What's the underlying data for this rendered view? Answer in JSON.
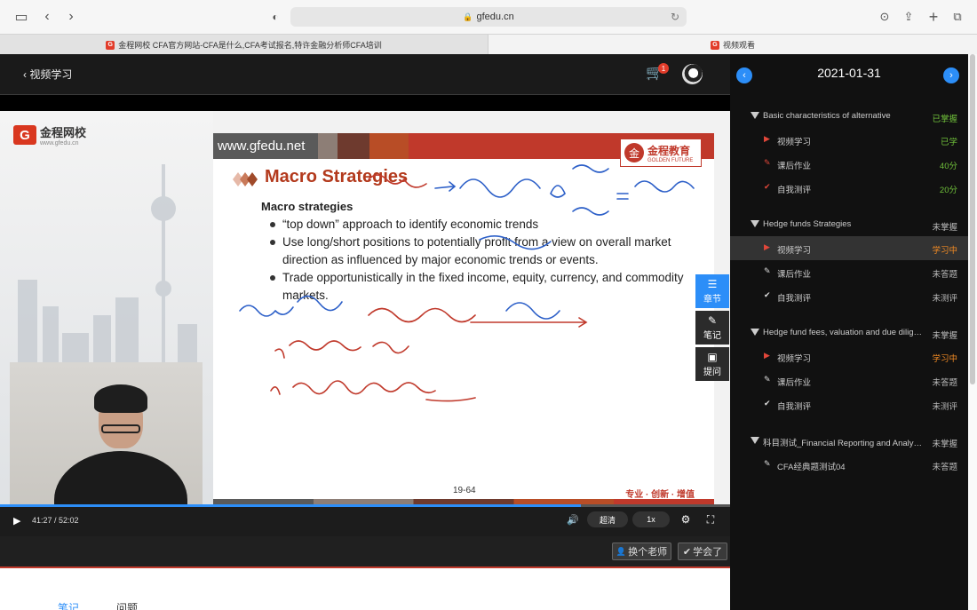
{
  "browser": {
    "url": "gfedu.cn",
    "tabs": [
      {
        "favicon": "G",
        "label": "金程网校 CFA官方网站-CFA是什么,CFA考试报名,特许金融分析师CFA培训"
      },
      {
        "favicon": "G",
        "label": "视频观看"
      }
    ]
  },
  "player": {
    "back_label": "视频学习",
    "cart_badge": "1",
    "video": {
      "logo_text": "金程网校",
      "logo_url": "www.gfedu.cn",
      "logo_mark": "G",
      "slide": {
        "url": "www.gfedu.net",
        "brand_cn": "金程教育",
        "brand_en": "GOLDEN FUTURE",
        "title": "Macro Strategies",
        "subtitle": "Macro strategies",
        "bullets": [
          "“top down” approach to identify economic trends",
          "Use long/short positions to potentially profit from a view on overall market direction as influenced by major economic trends or events.",
          "Trade opportunistically in the fixed income, equity, currency, and commodity markets."
        ],
        "page": "19-64",
        "slogan": "专业 · 创新 · 增值"
      }
    },
    "side_tools": [
      {
        "label": "章节",
        "icon": "list-icon"
      },
      {
        "label": "笔记",
        "icon": "pencil-icon"
      },
      {
        "label": "提问",
        "icon": "comment-icon"
      }
    ],
    "controls": {
      "time": "41:27 / 52:02",
      "progress": 0.796,
      "quality": "超清",
      "speed": "1x"
    },
    "actions": {
      "change_teacher": "换个老师",
      "learned": "学会了"
    }
  },
  "below_tabs": [
    "笔记",
    "问题"
  ],
  "panel": {
    "date": "2021-01-31",
    "sections": [
      {
        "title": "Basic characteristics of alternative",
        "status": "已掌握",
        "status_color": "#6fbf3a",
        "items": [
          {
            "label": "视频学习",
            "status": "已学",
            "color": "#6fbf3a",
            "icon": "play-icon"
          },
          {
            "label": "课后作业",
            "status": "40分",
            "color": "#6fbf3a",
            "icon": "pen-icon"
          },
          {
            "label": "自我测评",
            "status": "20分",
            "color": "#6fbf3a",
            "icon": "check-icon"
          }
        ]
      },
      {
        "title": "Hedge funds Strategies",
        "status": "未掌握",
        "status_color": "#bbbbbb",
        "items": [
          {
            "label": "视频学习",
            "status": "学习中",
            "color": "#f08a24",
            "icon": "play-icon"
          },
          {
            "label": "课后作业",
            "status": "未答题",
            "color": "#bbbbbb",
            "icon": "pen-icon"
          },
          {
            "label": "自我测评",
            "status": "未测评",
            "color": "#bbbbbb",
            "icon": "check-icon"
          }
        ]
      },
      {
        "title": "Hedge fund fees, valuation and due diligence",
        "status": "未掌握",
        "status_color": "#bbbbbb",
        "items": [
          {
            "label": "视频学习",
            "status": "学习中",
            "color": "#f08a24",
            "icon": "play-icon"
          },
          {
            "label": "课后作业",
            "status": "未答题",
            "color": "#bbbbbb",
            "icon": "pen-icon"
          },
          {
            "label": "自我测评",
            "status": "未测评",
            "color": "#bbbbbb",
            "icon": "check-icon"
          }
        ]
      },
      {
        "title": "科目测试_Financial Reporting and Analysis",
        "status": "未掌握",
        "status_color": "#bbbbbb",
        "items": [
          {
            "label": "CFA经典题测试04",
            "status": "未答题",
            "color": "#bbbbbb",
            "icon": "pen-icon"
          }
        ]
      }
    ]
  }
}
